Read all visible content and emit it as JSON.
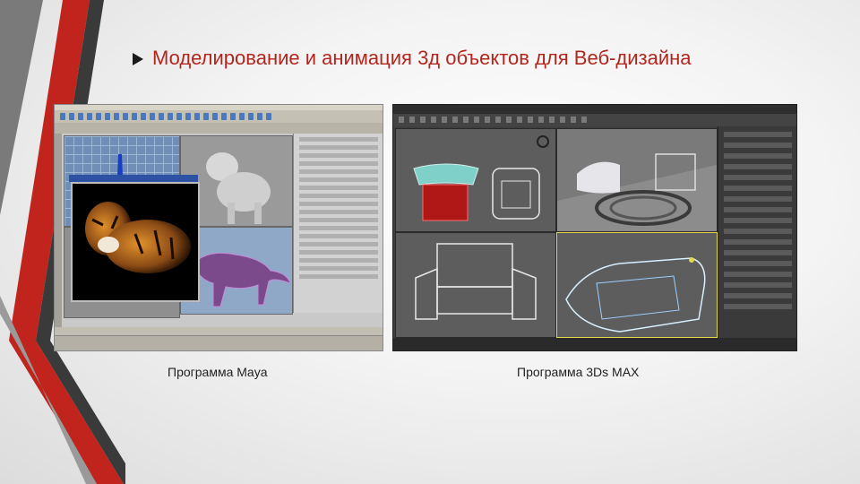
{
  "slide": {
    "title": "Моделирование и анимация 3д объектов для Веб-дизайна",
    "bullet_icon": "arrow-bullet-icon",
    "accent_color": "#b3261e",
    "decor_colors": [
      "#c0241c",
      "#3a3a3a",
      "#9a9a9a"
    ]
  },
  "screenshots": [
    {
      "caption": "Программа Maya",
      "image_icon": "maya-screenshot"
    },
    {
      "caption": "Программа 3Ds MAX",
      "image_icon": "3dsmax-screenshot"
    }
  ]
}
